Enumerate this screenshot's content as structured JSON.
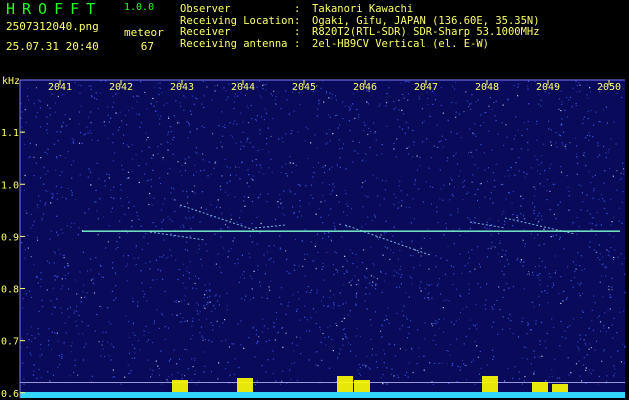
{
  "header": {
    "app_name": "HROFFT",
    "app_version": "1.0.0",
    "filename": "2507312040.png",
    "timestamp": "25.07.31 20:40",
    "mode_label": "meteor",
    "count": "67",
    "observer_label": "Observer",
    "observer_value": "Takanori Kawachi",
    "location_label": "Receiving Location",
    "location_value": "Ogaki, Gifu, JAPAN (136.60E, 35.35N)",
    "receiver_label": "Receiver",
    "receiver_value": "R820T2(RTL-SDR) SDR-Sharp 53.1000MHz",
    "antenna_label": "Receiving antenna",
    "antenna_value": "2el-HB9CV Vertical (el. E-W)",
    "separator": ":"
  },
  "chart_data": {
    "type": "heatmap",
    "ylabel": "kHz",
    "x_ticks": [
      "2041",
      "2042",
      "2043",
      "2044",
      "2045",
      "2046",
      "2047",
      "2048",
      "2049",
      "2050"
    ],
    "y_ticks": [
      "1.1",
      "1.0",
      "0.9",
      "0.8",
      "0.7",
      "0.6"
    ],
    "y_tick_values": [
      1.1,
      1.0,
      0.9,
      0.8,
      0.7,
      0.6
    ],
    "x_range": [
      2041,
      2050
    ],
    "y_range": [
      0.59,
      1.2
    ],
    "carrier_khz": 0.91,
    "ref_lines_khz": [
      0.62,
      0.6
    ],
    "colors": {
      "background": "#0a0a5a",
      "noise": "#3a5cff",
      "carrier": "#7cffd0",
      "echo": "#8fe0ff",
      "grid": "#7a7aff",
      "label": "#ffff66",
      "level": "#ffff00"
    }
  }
}
